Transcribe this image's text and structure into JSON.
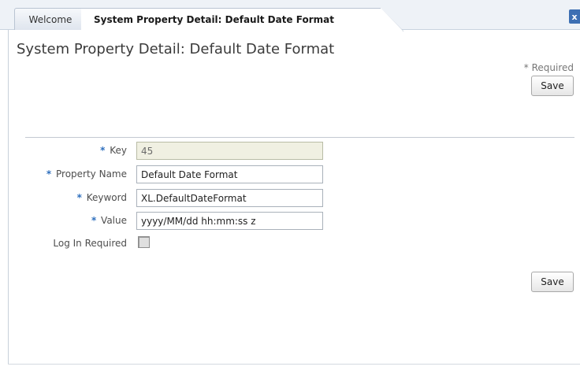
{
  "tabs": [
    {
      "label": "Welcome"
    },
    {
      "label": "System Property Detail: Default Date Format"
    }
  ],
  "close_tab_glyph": "x",
  "page": {
    "title": "System Property Detail: Default Date Format",
    "required_note": "* Required",
    "save_label_top": "Save",
    "save_label_bottom": "Save"
  },
  "form": {
    "required_marker": "*",
    "key": {
      "label": "Key",
      "value": "45"
    },
    "property_name": {
      "label": "Property Name",
      "value": "Default Date Format"
    },
    "keyword": {
      "label": "Keyword",
      "value": "XL.DefaultDateFormat"
    },
    "value": {
      "label": "Value",
      "value": "yyyy/MM/dd hh:mm:ss z"
    },
    "login_required": {
      "label": "Log In Required",
      "checked": false
    }
  },
  "colors": {
    "accent": "#2e6fbd",
    "tab_close": "#3d6fb3",
    "readonly_bg": "#f0f0e2"
  }
}
